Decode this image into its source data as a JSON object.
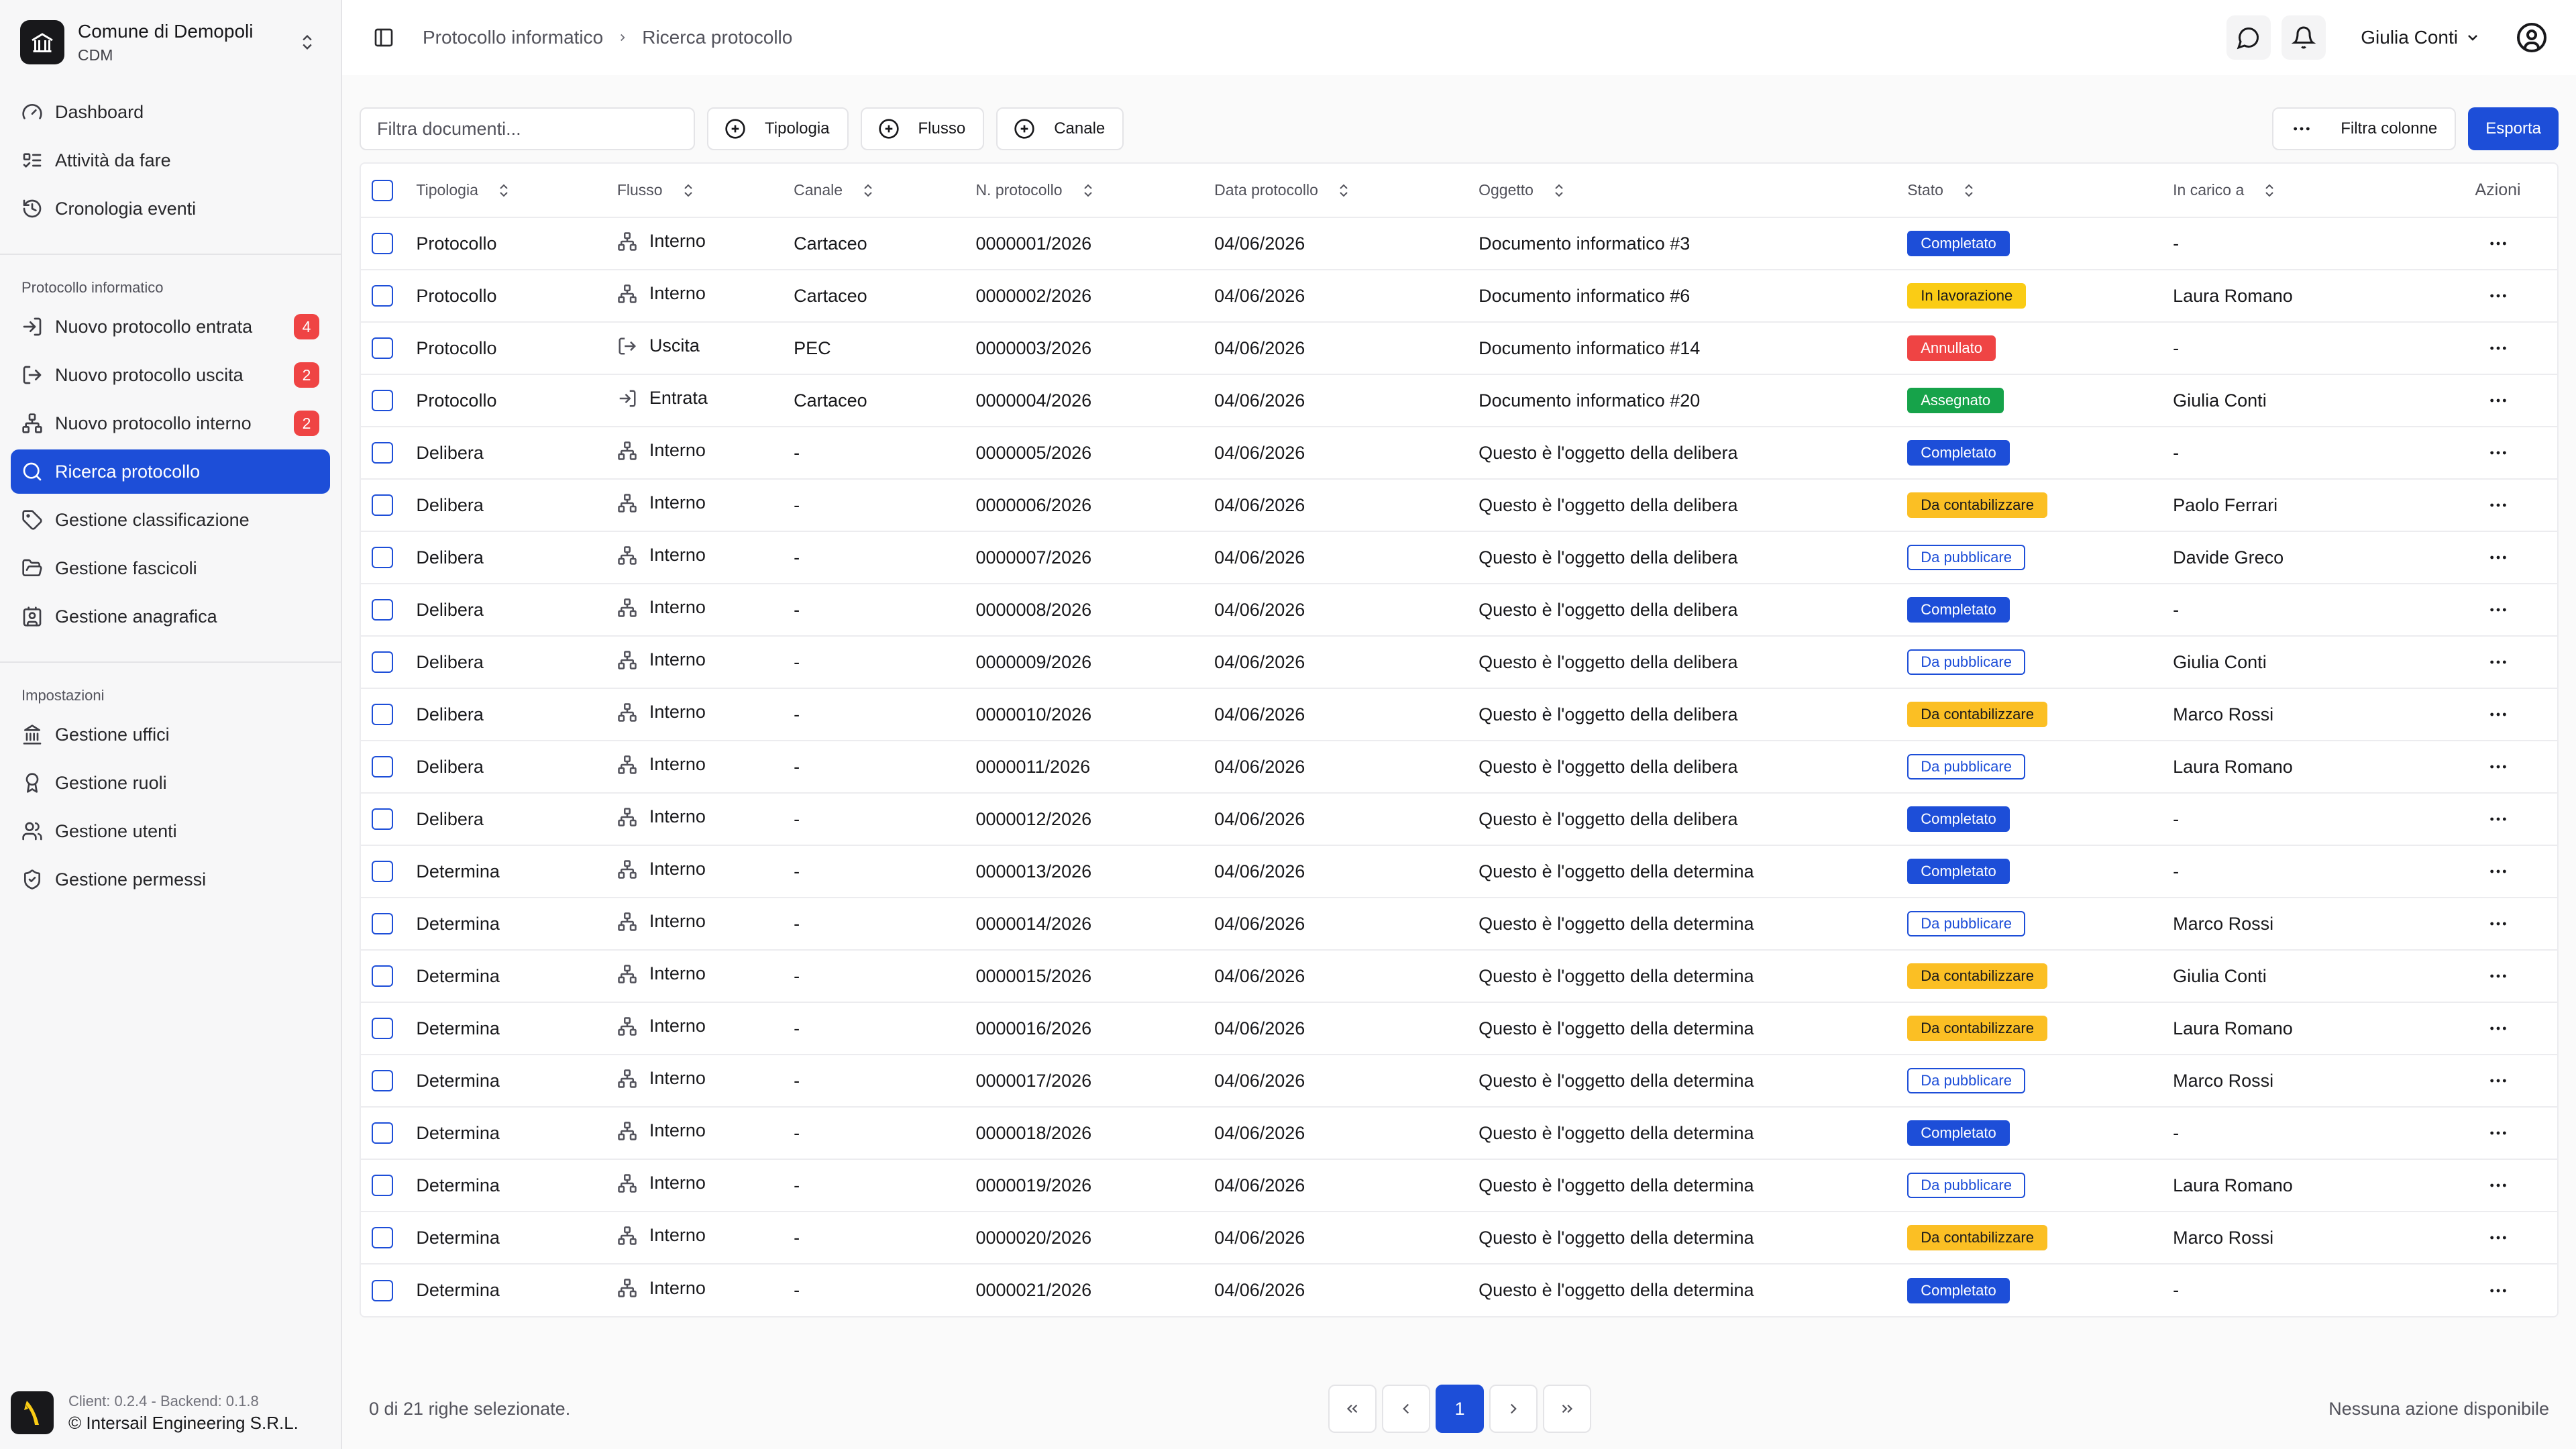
{
  "org": {
    "name": "Comune di Demopoli",
    "code": "CDM"
  },
  "nav_main": [
    {
      "label": "Dashboard",
      "icon": "gauge-icon"
    },
    {
      "label": "Attività da fare",
      "icon": "list-todo-icon"
    },
    {
      "label": "Cronologia eventi",
      "icon": "history-icon"
    }
  ],
  "group1": {
    "title": "Protocollo informatico",
    "items": [
      {
        "label": "Nuovo protocollo entrata",
        "badge": "4",
        "icon": "log-in-icon"
      },
      {
        "label": "Nuovo protocollo uscita",
        "badge": "2",
        "icon": "log-out-icon"
      },
      {
        "label": "Nuovo protocollo interno",
        "badge": "2",
        "icon": "network-icon"
      },
      {
        "label": "Ricerca protocollo",
        "badge": "",
        "icon": "search-icon",
        "active": true
      },
      {
        "label": "Gestione classificazione",
        "badge": "",
        "icon": "tag-icon"
      },
      {
        "label": "Gestione fascicoli",
        "badge": "",
        "icon": "folder-open-icon"
      },
      {
        "label": "Gestione anagrafica",
        "badge": "",
        "icon": "contact-icon"
      }
    ]
  },
  "group2": {
    "title": "Impostazioni",
    "items": [
      {
        "label": "Gestione uffici",
        "icon": "landmark-icon"
      },
      {
        "label": "Gestione ruoli",
        "icon": "award-icon"
      },
      {
        "label": "Gestione utenti",
        "icon": "users-icon"
      },
      {
        "label": "Gestione permessi",
        "icon": "shield-check-icon"
      }
    ]
  },
  "sidebar_footer": {
    "version": "Client: 0.2.4 - Backend: 0.1.8",
    "copyright": "© Intersail Engineering S.R.L."
  },
  "breadcrumb": {
    "parent": "Protocollo informatico",
    "current": "Ricerca protocollo"
  },
  "user": {
    "name": "Giulia Conti"
  },
  "toolbar": {
    "filter_placeholder": "Filtra documenti...",
    "filters": [
      "Tipologia",
      "Flusso",
      "Canale"
    ],
    "columns_label": "Filtra colonne",
    "export_label": "Esporta"
  },
  "table": {
    "headers": [
      "Tipologia",
      "Flusso",
      "Canale",
      "N. protocollo",
      "Data protocollo",
      "Oggetto",
      "Stato",
      "In carico a",
      "Azioni"
    ],
    "rows": [
      {
        "tipologia": "Protocollo",
        "flusso": "Interno",
        "canale": "Cartaceo",
        "numero": "0000001/2026",
        "data": "04/06/2026",
        "oggetto": "Documento informatico #3",
        "stato": "Completato",
        "carico": "-"
      },
      {
        "tipologia": "Protocollo",
        "flusso": "Interno",
        "canale": "Cartaceo",
        "numero": "0000002/2026",
        "data": "04/06/2026",
        "oggetto": "Documento informatico #6",
        "stato": "In lavorazione",
        "carico": "Laura Romano"
      },
      {
        "tipologia": "Protocollo",
        "flusso": "Uscita",
        "canale": "PEC",
        "numero": "0000003/2026",
        "data": "04/06/2026",
        "oggetto": "Documento informatico #14",
        "stato": "Annullato",
        "carico": "-"
      },
      {
        "tipologia": "Protocollo",
        "flusso": "Entrata",
        "canale": "Cartaceo",
        "numero": "0000004/2026",
        "data": "04/06/2026",
        "oggetto": "Documento informatico #20",
        "stato": "Assegnato",
        "carico": "Giulia Conti"
      },
      {
        "tipologia": "Delibera",
        "flusso": "Interno",
        "canale": "-",
        "numero": "0000005/2026",
        "data": "04/06/2026",
        "oggetto": "Questo è l'oggetto della delibera",
        "stato": "Completato",
        "carico": "-"
      },
      {
        "tipologia": "Delibera",
        "flusso": "Interno",
        "canale": "-",
        "numero": "0000006/2026",
        "data": "04/06/2026",
        "oggetto": "Questo è l'oggetto della delibera",
        "stato": "Da contabilizzare",
        "carico": "Paolo Ferrari"
      },
      {
        "tipologia": "Delibera",
        "flusso": "Interno",
        "canale": "-",
        "numero": "0000007/2026",
        "data": "04/06/2026",
        "oggetto": "Questo è l'oggetto della delibera",
        "stato": "Da pubblicare",
        "carico": "Davide Greco"
      },
      {
        "tipologia": "Delibera",
        "flusso": "Interno",
        "canale": "-",
        "numero": "0000008/2026",
        "data": "04/06/2026",
        "oggetto": "Questo è l'oggetto della delibera",
        "stato": "Completato",
        "carico": "-"
      },
      {
        "tipologia": "Delibera",
        "flusso": "Interno",
        "canale": "-",
        "numero": "0000009/2026",
        "data": "04/06/2026",
        "oggetto": "Questo è l'oggetto della delibera",
        "stato": "Da pubblicare",
        "carico": "Giulia Conti"
      },
      {
        "tipologia": "Delibera",
        "flusso": "Interno",
        "canale": "-",
        "numero": "0000010/2026",
        "data": "04/06/2026",
        "oggetto": "Questo è l'oggetto della delibera",
        "stato": "Da contabilizzare",
        "carico": "Marco Rossi"
      },
      {
        "tipologia": "Delibera",
        "flusso": "Interno",
        "canale": "-",
        "numero": "0000011/2026",
        "data": "04/06/2026",
        "oggetto": "Questo è l'oggetto della delibera",
        "stato": "Da pubblicare",
        "carico": "Laura Romano"
      },
      {
        "tipologia": "Delibera",
        "flusso": "Interno",
        "canale": "-",
        "numero": "0000012/2026",
        "data": "04/06/2026",
        "oggetto": "Questo è l'oggetto della delibera",
        "stato": "Completato",
        "carico": "-"
      },
      {
        "tipologia": "Determina",
        "flusso": "Interno",
        "canale": "-",
        "numero": "0000013/2026",
        "data": "04/06/2026",
        "oggetto": "Questo è l'oggetto della determina",
        "stato": "Completato",
        "carico": "-"
      },
      {
        "tipologia": "Determina",
        "flusso": "Interno",
        "canale": "-",
        "numero": "0000014/2026",
        "data": "04/06/2026",
        "oggetto": "Questo è l'oggetto della determina",
        "stato": "Da pubblicare",
        "carico": "Marco Rossi"
      },
      {
        "tipologia": "Determina",
        "flusso": "Interno",
        "canale": "-",
        "numero": "0000015/2026",
        "data": "04/06/2026",
        "oggetto": "Questo è l'oggetto della determina",
        "stato": "Da contabilizzare",
        "carico": "Giulia Conti"
      },
      {
        "tipologia": "Determina",
        "flusso": "Interno",
        "canale": "-",
        "numero": "0000016/2026",
        "data": "04/06/2026",
        "oggetto": "Questo è l'oggetto della determina",
        "stato": "Da contabilizzare",
        "carico": "Laura Romano"
      },
      {
        "tipologia": "Determina",
        "flusso": "Interno",
        "canale": "-",
        "numero": "0000017/2026",
        "data": "04/06/2026",
        "oggetto": "Questo è l'oggetto della determina",
        "stato": "Da pubblicare",
        "carico": "Marco Rossi"
      },
      {
        "tipologia": "Determina",
        "flusso": "Interno",
        "canale": "-",
        "numero": "0000018/2026",
        "data": "04/06/2026",
        "oggetto": "Questo è l'oggetto della determina",
        "stato": "Completato",
        "carico": "-"
      },
      {
        "tipologia": "Determina",
        "flusso": "Interno",
        "canale": "-",
        "numero": "0000019/2026",
        "data": "04/06/2026",
        "oggetto": "Questo è l'oggetto della determina",
        "stato": "Da pubblicare",
        "carico": "Laura Romano"
      },
      {
        "tipologia": "Determina",
        "flusso": "Interno",
        "canale": "-",
        "numero": "0000020/2026",
        "data": "04/06/2026",
        "oggetto": "Questo è l'oggetto della determina",
        "stato": "Da contabilizzare",
        "carico": "Marco Rossi"
      },
      {
        "tipologia": "Determina",
        "flusso": "Interno",
        "canale": "-",
        "numero": "0000021/2026",
        "data": "04/06/2026",
        "oggetto": "Questo è l'oggetto della determina",
        "stato": "Completato",
        "carico": "-"
      }
    ]
  },
  "footer": {
    "selection": "0 di 21 righe selezionate.",
    "current_page": "1",
    "no_actions": "Nessuna azione disponibile"
  },
  "colors": {
    "primary": "#1d4ed8",
    "danger": "#ef4444",
    "warning": "#fbbf24",
    "success": "#16a34a"
  }
}
